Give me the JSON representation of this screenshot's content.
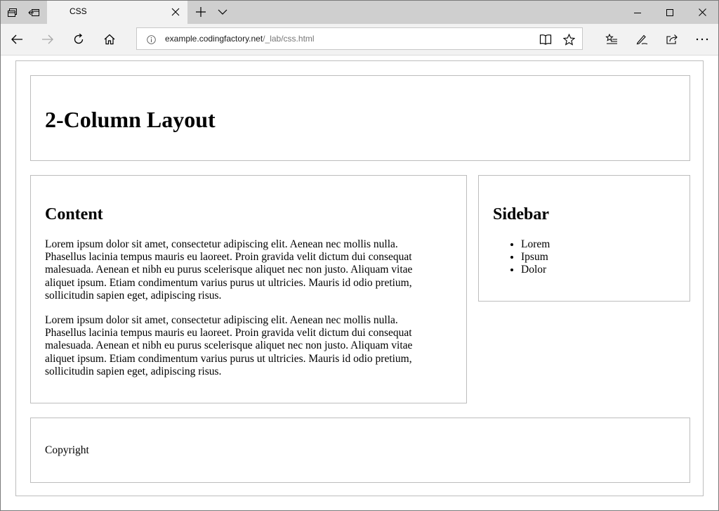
{
  "browser": {
    "tab": {
      "title": "CSS"
    },
    "address": {
      "host": "example.codingfactory.net",
      "path": "/_lab/css.html"
    }
  },
  "page": {
    "header": {
      "title": "2-Column Layout"
    },
    "content": {
      "heading": "Content",
      "paragraphs": [
        "Lorem ipsum dolor sit amet, consectetur adipiscing elit. Aenean nec mollis nulla. Phasellus lacinia tempus mauris eu laoreet. Proin gravida velit dictum dui consequat malesuada. Aenean et nibh eu purus scelerisque aliquet nec non justo. Aliquam vitae aliquet ipsum. Etiam condimentum varius purus ut ultricies. Mauris id odio pretium, sollicitudin sapien eget, adipiscing risus.",
        "Lorem ipsum dolor sit amet, consectetur adipiscing elit. Aenean nec mollis nulla. Phasellus lacinia tempus mauris eu laoreet. Proin gravida velit dictum dui consequat malesuada. Aenean et nibh eu purus scelerisque aliquet nec non justo. Aliquam vitae aliquet ipsum. Etiam condimentum varius purus ut ultricies. Mauris id odio pretium, sollicitudin sapien eget, adipiscing risus."
      ]
    },
    "sidebar": {
      "heading": "Sidebar",
      "items": [
        "Lorem",
        "Ipsum",
        "Dolor"
      ]
    },
    "footer": {
      "text": "Copyright"
    }
  },
  "icons": {
    "set_aside_tabs": "tabs-aside-icon",
    "restore_tabs": "restore-tabs-icon",
    "close_tab": "close-icon",
    "new_tab": "plus-icon",
    "tab_preview": "chevron-down-icon",
    "minimize": "minimize-icon",
    "maximize": "maximize-icon",
    "close_window": "close-icon",
    "back": "back-arrow-icon",
    "forward": "forward-arrow-icon",
    "refresh": "refresh-icon",
    "home": "home-icon",
    "site_info": "info-icon",
    "reading_view": "book-icon",
    "favorite": "star-icon",
    "favorites_hub": "favorites-list-icon",
    "web_note": "pen-icon",
    "share": "share-icon",
    "more": "more-icon"
  },
  "colors": {
    "tabbar_bg": "#cfcfcf",
    "active_tab_bg": "#f2f2f2",
    "navbar_bg": "#f2f2f2",
    "box_border": "#bdbdbd",
    "url_path": "#767676"
  }
}
